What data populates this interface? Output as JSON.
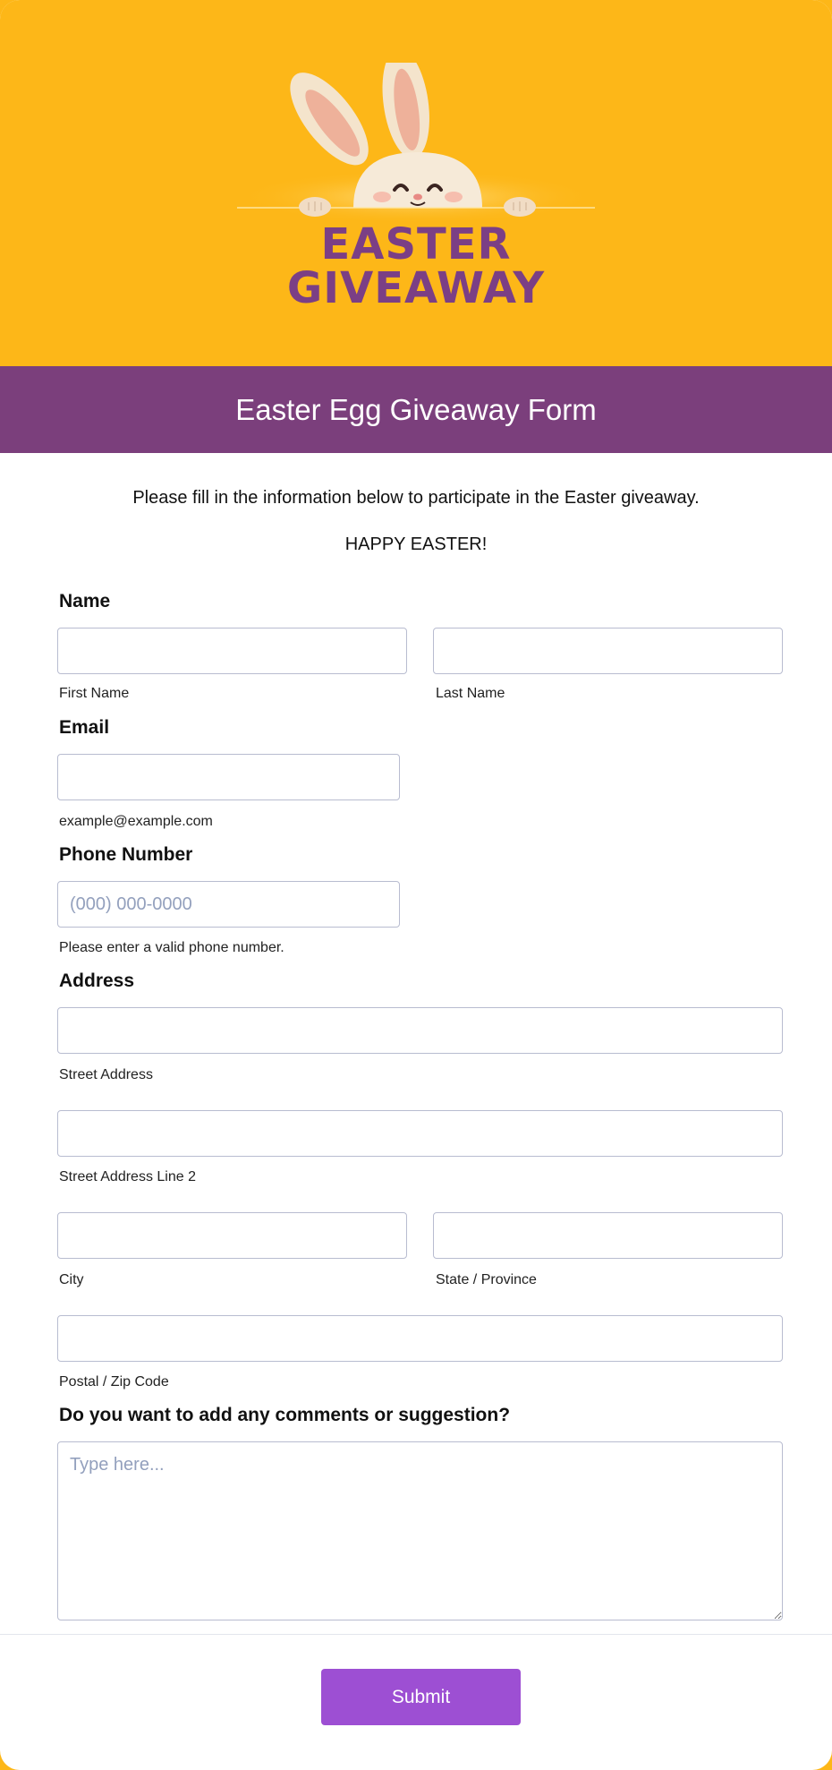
{
  "hero": {
    "line1": "EASTER",
    "line2": "GIVEAWAY",
    "image_icon": "bunny-peeking-icon",
    "background_color": "#fdb718",
    "title_color": "#7b3f85"
  },
  "form": {
    "title": "Easter Egg Giveaway Form",
    "banner_color": "#7b3f7c",
    "intro": "Please fill in the information below to participate in the Easter giveaway.",
    "greeting": "HAPPY EASTER!",
    "name": {
      "label": "Name",
      "first_value": "",
      "last_value": "",
      "first_sublabel": "First Name",
      "last_sublabel": "Last Name"
    },
    "email": {
      "label": "Email",
      "value": "",
      "sublabel": "example@example.com"
    },
    "phone": {
      "label": "Phone Number",
      "placeholder": "(000) 000-0000",
      "sublabel": "Please enter a valid phone number."
    },
    "address": {
      "label": "Address",
      "street_sublabel": "Street Address",
      "street2_sublabel": "Street Address Line 2",
      "city_sublabel": "City",
      "state_sublabel": "State / Province",
      "zip_sublabel": "Postal / Zip Code"
    },
    "comments": {
      "label": "Do you want to add any comments or suggestion?",
      "placeholder": "Type here..."
    },
    "submit_label": "Submit",
    "submit_color": "#9d4fd3"
  }
}
